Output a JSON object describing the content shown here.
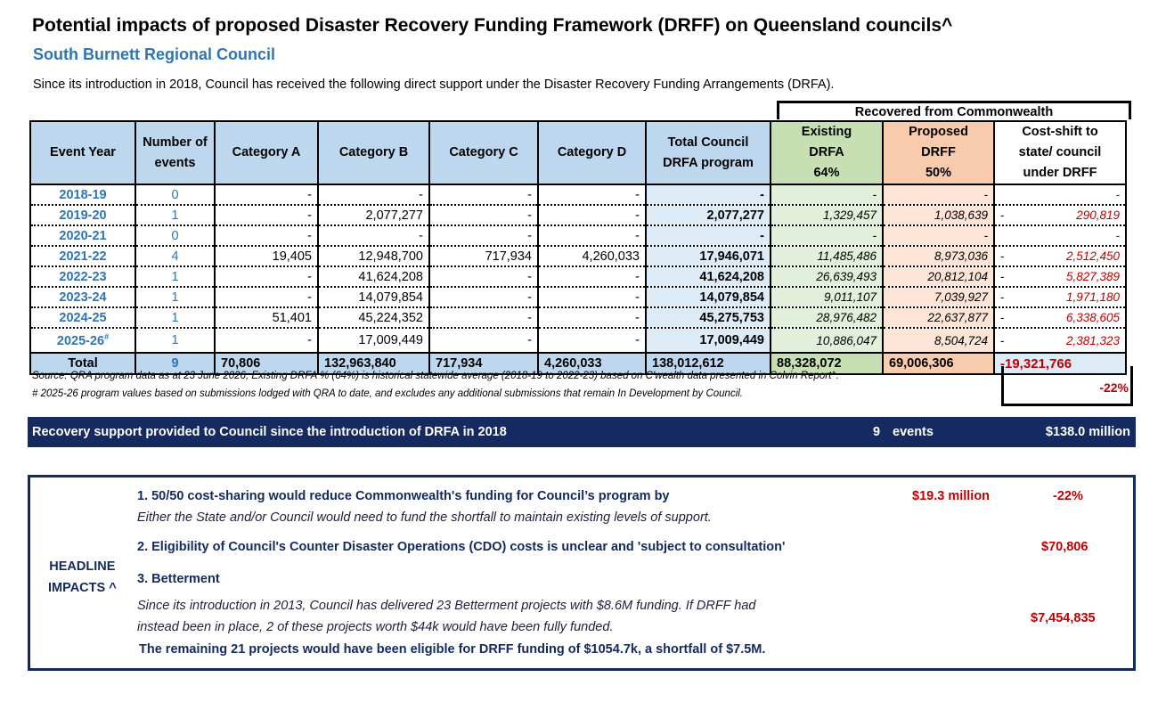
{
  "title": "Potential impacts of proposed Disaster Recovery Funding Framework (DRFF) on Queensland councils^",
  "subtitle": "South Burnett Regional Council",
  "intro": "Since its introduction in 2018, Council has received the following direct support under the Disaster Recovery Funding Arrangements (DRFA).",
  "recovered_header": "Recovered from Commonwealth",
  "columns": {
    "event_year": "Event Year",
    "num_events": [
      "Number of",
      "events"
    ],
    "cat_a": "Category A",
    "cat_b": "Category B",
    "cat_c": "Category C",
    "cat_d": "Category D",
    "total": [
      "Total Council",
      "DRFA program"
    ],
    "existing": [
      "Existing",
      "DRFA",
      "64%"
    ],
    "proposed": [
      "Proposed",
      "DRFF",
      "50%"
    ],
    "costshift": [
      "Cost-shift to",
      "state/ council",
      "under DRFF"
    ]
  },
  "rows": [
    {
      "year": "2018-19",
      "events": "0",
      "a": "-",
      "b": "-",
      "c": "-",
      "d": "-",
      "total": "-",
      "existing": "-",
      "proposed": "-",
      "shift": "-",
      "shift_dash": ""
    },
    {
      "year": "2019-20",
      "events": "1",
      "a": "-",
      "b": "2,077,277",
      "c": "-",
      "d": "-",
      "total": "2,077,277",
      "existing": "1,329,457",
      "proposed": "1,038,639",
      "shift": "290,819",
      "shift_dash": "-"
    },
    {
      "year": "2020-21",
      "events": "0",
      "a": "-",
      "b": "-",
      "c": "-",
      "d": "-",
      "total": "-",
      "existing": "-",
      "proposed": "-",
      "shift": "-",
      "shift_dash": ""
    },
    {
      "year": "2021-22",
      "events": "4",
      "a": "19,405",
      "b": "12,948,700",
      "c": "717,934",
      "d": "4,260,033",
      "total": "17,946,071",
      "existing": "11,485,486",
      "proposed": "8,973,036",
      "shift": "2,512,450",
      "shift_dash": "-"
    },
    {
      "year": "2022-23",
      "events": "1",
      "a": "-",
      "b": "41,624,208",
      "c": "-",
      "d": "-",
      "total": "41,624,208",
      "existing": "26,639,493",
      "proposed": "20,812,104",
      "shift": "5,827,389",
      "shift_dash": "-"
    },
    {
      "year": "2023-24",
      "events": "1",
      "a": "-",
      "b": "14,079,854",
      "c": "-",
      "d": "-",
      "total": "14,079,854",
      "existing": "9,011,107",
      "proposed": "7,039,927",
      "shift": "1,971,180",
      "shift_dash": "-"
    },
    {
      "year": "2024-25",
      "events": "1",
      "a": "51,401",
      "b": "45,224,352",
      "c": "-",
      "d": "-",
      "total": "45,275,753",
      "existing": "28,976,482",
      "proposed": "22,637,877",
      "shift": "6,338,605",
      "shift_dash": "-"
    },
    {
      "year": "2025-26",
      "year_sup": "#",
      "events": "1",
      "a": "-",
      "b": "17,009,449",
      "c": "-",
      "d": "-",
      "total": "17,009,449",
      "existing": "10,886,047",
      "proposed": "8,504,724",
      "shift": "2,381,323",
      "shift_dash": "-"
    }
  ],
  "totals": {
    "label": "Total",
    "events": "9",
    "a": "70,806",
    "b": "132,963,840",
    "c": "717,934",
    "d": "4,260,033",
    "total": "138,012,612",
    "existing": "88,328,072",
    "proposed": "69,006,306",
    "shift": "19,321,766",
    "shift_dash": "-"
  },
  "source_note": "Source: QRA program data as at 23 June 2026, Existing DRFA % (64%) is historical statewide average (2018-19 to 2022-23)  based on C'wealth data presented in Colvin Report^.",
  "hash_note": "# 2025-26 program values based on submissions lodged with QRA to date, and excludes any additional submissions that remain In Development by Council.",
  "pct_shift": "-22%",
  "banner": {
    "text": "Recovery support provided to Council since the introduction of DRFA in 2018",
    "events_count": "9",
    "events_label": "events",
    "amount": "$138.0 million"
  },
  "impacts": {
    "label": [
      "HEADLINE",
      "IMPACTS ^"
    ],
    "item1_title": "1. 50/50 cost-sharing would reduce Commonwealth's funding for Council’s program by",
    "item1_amount": "$19.3 million",
    "item1_pct": "-22%",
    "item1_note": "Either the State and/or Council would need to fund the shortfall to maintain existing levels of support.",
    "item2_title": "2. Eligibility of Council's Counter Disaster Operations (CDO) costs is unclear and 'subject to consultation'",
    "item2_amount": "$70,806",
    "item3_title": "3. Betterment",
    "item3_line1": " Since its introduction in 2013, Council has delivered 23 Betterment projects with $8.6M funding. If DRFF had",
    "item3_line2": "instead been in place, 2 of these projects worth $44k would have been fully funded.",
    "item3_line3": "The remaining 21 projects would have been eligible for DRFF funding of $1054.7k, a shortfall of $7.5M.",
    "item3_amount": "$7,454,835"
  }
}
